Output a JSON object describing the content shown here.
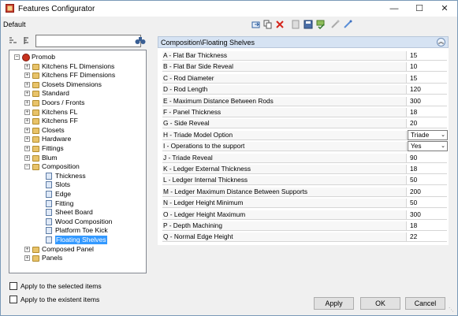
{
  "window": {
    "title": "Features Configurator",
    "minimize": "—",
    "maximize": "☐",
    "close": "✕"
  },
  "config": {
    "name": "Default"
  },
  "toolbar": [
    {
      "name": "import-icon"
    },
    {
      "name": "copy-icon"
    },
    {
      "name": "delete-icon"
    },
    {
      "name": "page-icon"
    },
    {
      "name": "save-icon"
    },
    {
      "name": "apply-icon"
    },
    {
      "name": "link-icon"
    },
    {
      "name": "edit-link-icon"
    }
  ],
  "search": {
    "value": "",
    "placeholder": ""
  },
  "tree": [
    {
      "label": "Promob",
      "level": 0,
      "type": "root",
      "expander": "−"
    },
    {
      "label": "Kitchens FL Dimensions",
      "level": 1,
      "type": "folder",
      "expander": "+"
    },
    {
      "label": "Kitchens FF Dimensions",
      "level": 1,
      "type": "folder",
      "expander": "+"
    },
    {
      "label": "Closets Dimensions",
      "level": 1,
      "type": "folder",
      "expander": "+"
    },
    {
      "label": "Standard",
      "level": 1,
      "type": "folder",
      "expander": "+"
    },
    {
      "label": "Doors / Fronts",
      "level": 1,
      "type": "folder",
      "expander": "+"
    },
    {
      "label": "Kitchens FL",
      "level": 1,
      "type": "folder",
      "expander": "+"
    },
    {
      "label": "Kitchens FF",
      "level": 1,
      "type": "folder",
      "expander": "+"
    },
    {
      "label": "Closets",
      "level": 1,
      "type": "folder",
      "expander": "+"
    },
    {
      "label": "Hardware",
      "level": 1,
      "type": "folder",
      "expander": "+"
    },
    {
      "label": "Fittings",
      "level": 1,
      "type": "folder",
      "expander": "+"
    },
    {
      "label": "Blum",
      "level": 1,
      "type": "folder",
      "expander": "+"
    },
    {
      "label": "Composition",
      "level": 1,
      "type": "folder",
      "expander": "−"
    },
    {
      "label": "Thickness",
      "level": 2,
      "type": "doc"
    },
    {
      "label": "Slots",
      "level": 2,
      "type": "doc"
    },
    {
      "label": "Edge",
      "level": 2,
      "type": "doc"
    },
    {
      "label": "Fitting",
      "level": 2,
      "type": "doc"
    },
    {
      "label": "Sheet Board",
      "level": 2,
      "type": "doc"
    },
    {
      "label": "Wood Composition",
      "level": 2,
      "type": "doc"
    },
    {
      "label": "Platform Toe Kick",
      "level": 2,
      "type": "doc"
    },
    {
      "label": "Floating Shelves",
      "level": 2,
      "type": "doc",
      "selected": true
    },
    {
      "label": "Composed Panel",
      "level": 1,
      "type": "folder",
      "expander": "+"
    },
    {
      "label": "Panels",
      "level": 1,
      "type": "folder",
      "expander": "+"
    }
  ],
  "grid": {
    "header": "Composition\\Floating Shelves",
    "rows": [
      {
        "name": "A - Flat Bar Thickness",
        "value": "15"
      },
      {
        "name": "B - Flat Bar Side Reveal",
        "value": "10"
      },
      {
        "name": "C - Rod Diameter",
        "value": "15"
      },
      {
        "name": "D - Rod Length",
        "value": "120"
      },
      {
        "name": "E - Maximum Distance Between Rods",
        "value": "300"
      },
      {
        "name": "F - Panel Thickness",
        "value": "18"
      },
      {
        "name": "G - Side Reveal",
        "value": "20"
      },
      {
        "name": "H - Triade Model Option",
        "value": "Triade",
        "dropdown": true
      },
      {
        "name": "I - Operations to the support",
        "value": "Yes",
        "dropdown": true
      },
      {
        "name": "J - Triade Reveal",
        "value": "90"
      },
      {
        "name": "K - Ledger External Thickness",
        "value": "18"
      },
      {
        "name": "L - Ledger Internal Thickness",
        "value": "50"
      },
      {
        "name": "M - Ledger Maximum Distance Between Supports",
        "value": "200"
      },
      {
        "name": "N - Ledger Height Minimum",
        "value": "50"
      },
      {
        "name": "O - Ledger Height Maximum",
        "value": "300"
      },
      {
        "name": "P - Depth Machining",
        "value": "18"
      },
      {
        "name": "Q - Normal Edge Height",
        "value": "22"
      }
    ]
  },
  "options": {
    "apply_selected": "Apply to the selected items",
    "apply_existent": "Apply to the existent items"
  },
  "buttons": {
    "apply": "Apply",
    "ok": "OK",
    "cancel": "Cancel"
  }
}
